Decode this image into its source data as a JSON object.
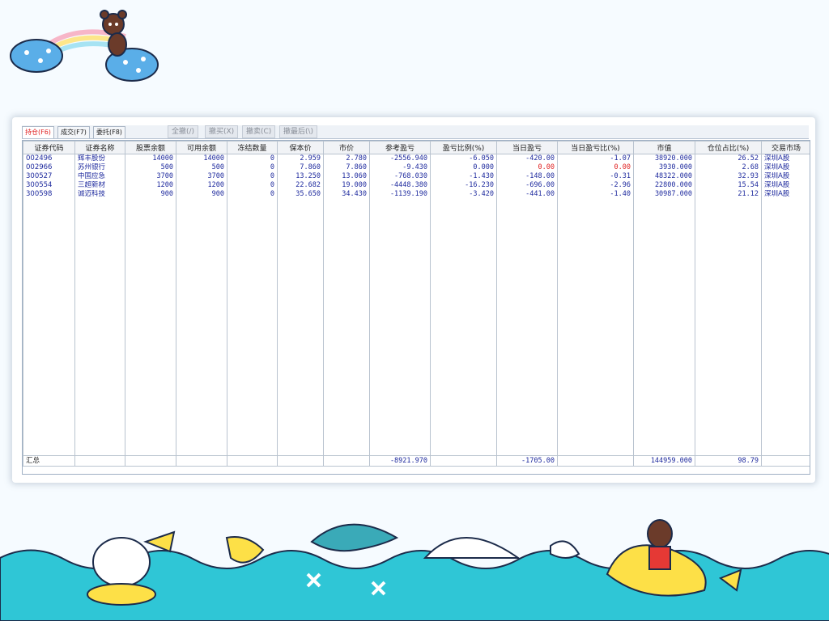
{
  "tabs": [
    {
      "label": "持仓(F6)",
      "active": true
    },
    {
      "label": "成交(F7)",
      "active": false
    },
    {
      "label": "委托(F8)",
      "active": false
    }
  ],
  "toolbar": [
    "全撤(/)",
    "撤买(X)",
    "撤卖(C)",
    "撤最后(\\)"
  ],
  "columns": [
    "证券代码",
    "证券名称",
    "股票余额",
    "可用余额",
    "冻结数量",
    "保本价",
    "市价",
    "参考盈亏",
    "盈亏比例(%)",
    "当日盈亏",
    "当日盈亏比(%)",
    "市值",
    "仓位占比(%)",
    "交易市场"
  ],
  "rows": [
    [
      "002496",
      "辉丰股份",
      "14000",
      "14000",
      "0",
      "2.959",
      "2.780",
      "-2556.940",
      "-6.050",
      "-420.00",
      "-1.07",
      "38920.000",
      "26.52",
      "深圳A股"
    ],
    [
      "002966",
      "苏州银行",
      "500",
      "500",
      "0",
      "7.860",
      "7.860",
      "-9.430",
      "0.000",
      "0.00",
      "0.00",
      "3930.000",
      "2.68",
      "深圳A股"
    ],
    [
      "300527",
      "中国应急",
      "3700",
      "3700",
      "0",
      "13.250",
      "13.060",
      "-768.030",
      "-1.430",
      "-148.00",
      "-0.31",
      "48322.000",
      "32.93",
      "深圳A股"
    ],
    [
      "300554",
      "三超新材",
      "1200",
      "1200",
      "0",
      "22.682",
      "19.000",
      "-4448.380",
      "-16.230",
      "-696.00",
      "-2.96",
      "22800.000",
      "15.54",
      "深圳A股"
    ],
    [
      "300598",
      "诚迈科技",
      "900",
      "900",
      "0",
      "35.650",
      "34.430",
      "-1139.190",
      "-3.420",
      "-441.00",
      "-1.40",
      "30987.000",
      "21.12",
      "深圳A股"
    ]
  ],
  "total": {
    "label": "汇总",
    "ref_pl": "-8921.970",
    "day_pl": "-1705.00",
    "market_value": "144959.000",
    "position_ratio": "98.79"
  },
  "colors": {
    "text_blue": "#1e2a9e",
    "zero_red": "#e02020",
    "sea": "#2fc6d6"
  }
}
